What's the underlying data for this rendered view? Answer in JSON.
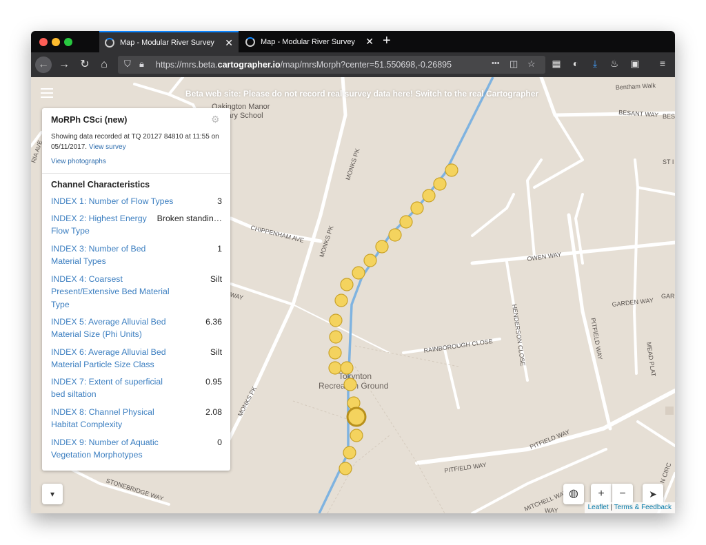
{
  "browser": {
    "tabs": [
      {
        "title": "Map - Modular River Survey",
        "close": "✕"
      },
      {
        "title": "Map - Modular River Survey",
        "close": "✕"
      }
    ],
    "new_tab": "+",
    "url_prefix": "https://mrs.beta.",
    "url_domain": "cartographer.io",
    "url_suffix": "/map/mrsMorph?center=51.550698,-0.26895",
    "more_icon": "•••"
  },
  "banner": {
    "text": "Beta web site: Please do not record real survey data here!",
    "link": "Switch to the real Cartographer"
  },
  "map": {
    "labels": [
      {
        "text": "Oakington Manor"
      },
      {
        "text": "Primary School"
      },
      {
        "text": "Bentham Walk"
      },
      {
        "text": "BESANT WAY"
      },
      {
        "text": "BES"
      },
      {
        "text": "ST I"
      },
      {
        "text": "MONKS PK"
      },
      {
        "text": "MONKS PK"
      },
      {
        "text": "MONKS PK"
      },
      {
        "text": "CHIPPENHAM AVE"
      },
      {
        "text": "OWEN WAY"
      },
      {
        "text": "GARDEN WAY"
      },
      {
        "text": "GAR"
      },
      {
        "text": "HENDERSON CLOSE"
      },
      {
        "text": "RAINBOROUGH CLOSE"
      },
      {
        "text": "PITFIELD WAY"
      },
      {
        "text": "PITFIELD WAY"
      },
      {
        "text": "PITFIELD WAY"
      },
      {
        "text": "MEAD PLAT"
      },
      {
        "text": "Tokynton"
      },
      {
        "text": "Recreation Ground"
      },
      {
        "text": "STONEBRIDGE WAY"
      },
      {
        "text": "MITCHELL WAY"
      },
      {
        "text": "N CIRC"
      },
      {
        "text": "WAY"
      },
      {
        "text": "RIA AVE"
      },
      {
        "text": "WAY"
      }
    ],
    "colors": {
      "land": "#e6dfd5",
      "road": "#ffffff",
      "river": "#7fb3e0",
      "marker_fill": "#f4d35e",
      "marker_stroke": "#c9a227",
      "link": "#3b7ec0"
    }
  },
  "panel": {
    "title": "MoRPh CSci (new)",
    "info": "Showing data recorded at TQ 20127 84810 at 11:55 on 05/11/2017.",
    "view_survey": "View survey",
    "view_photographs": "View photographs",
    "section": "Channel Characteristics",
    "rows": [
      {
        "label": "INDEX 1: Number of Flow Types",
        "value": "3"
      },
      {
        "label": "INDEX 2: Highest Energy Flow Type",
        "value": "Broken standin…"
      },
      {
        "label": "INDEX 3: Number of Bed Material Types",
        "value": "1"
      },
      {
        "label": "INDEX 4: Coarsest Present/Extensive Bed Material Type",
        "value": "Silt"
      },
      {
        "label": "INDEX 5: Average Alluvial Bed Material Size (Phi Units)",
        "value": "6.36"
      },
      {
        "label": "INDEX 6: Average Alluvial Bed Material Particle Size Class",
        "value": "Silt"
      },
      {
        "label": "INDEX 7: Extent of superficial bed siltation",
        "value": "0.95"
      },
      {
        "label": "INDEX 8: Channel Physical Habitat Complexity",
        "value": "2.08"
      },
      {
        "label": "INDEX 9: Number of Aquatic Vegetation Morphotypes",
        "value": "0"
      }
    ]
  },
  "controls": {
    "zoom_in": "+",
    "zoom_out": "−",
    "locate": "➤",
    "globe": "◍",
    "collapse": "▾"
  },
  "attribution": {
    "leaflet": "Leaflet",
    "separator": " | ",
    "terms": "Terms & Feedback"
  }
}
